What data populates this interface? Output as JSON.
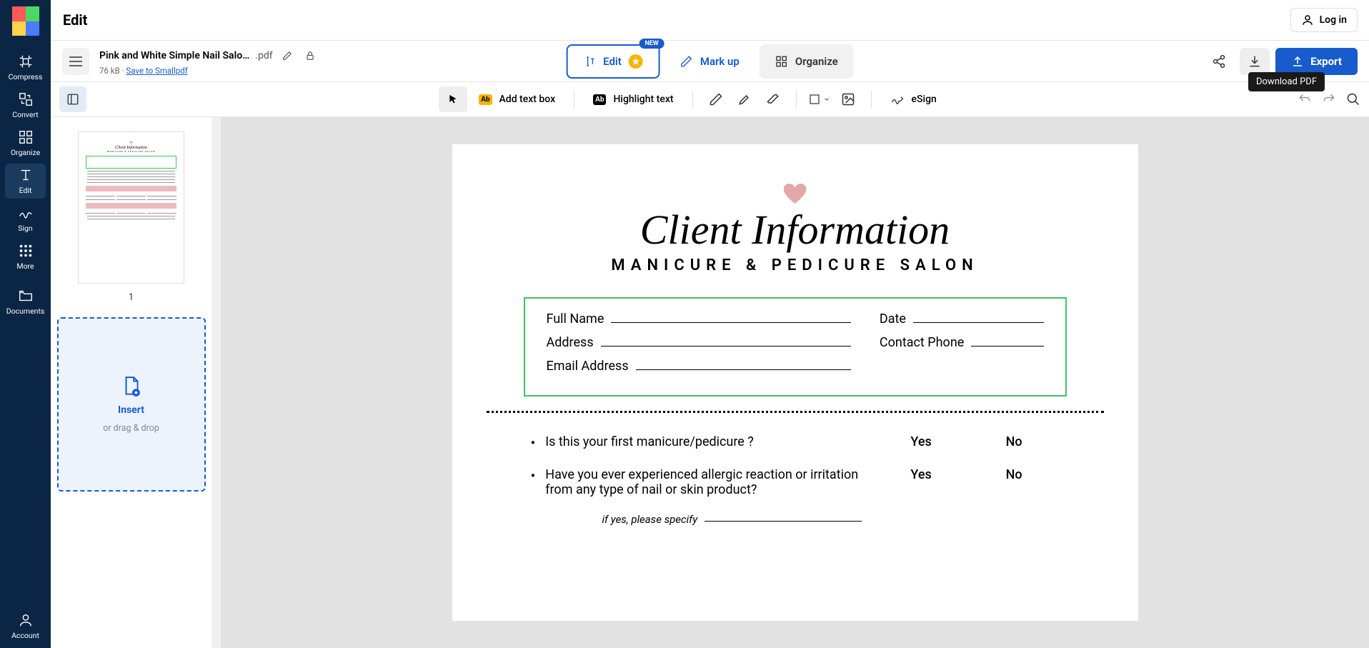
{
  "header": {
    "title": "Edit",
    "login": "Log in"
  },
  "sidebar": {
    "items": [
      {
        "label": "Compress"
      },
      {
        "label": "Convert"
      },
      {
        "label": "Organize"
      },
      {
        "label": "Edit"
      },
      {
        "label": "Sign"
      },
      {
        "label": "More"
      },
      {
        "label": "Documents"
      }
    ],
    "account": "Account"
  },
  "file": {
    "name": "Pink and White Simple Nail Salo…",
    "ext": ".pdf",
    "size": "76 kB",
    "save": "Save to Smallpdf"
  },
  "tabs": {
    "edit": "Edit",
    "markup": "Mark up",
    "organize": "Organize",
    "new_badge": "NEW"
  },
  "actions": {
    "export": "Export"
  },
  "toolbar": {
    "add_text": "Add text box",
    "highlight": "Highlight text",
    "esign": "eSign",
    "tooltip": "Download PDF"
  },
  "thumbs": {
    "page_num": "1",
    "insert": "Insert",
    "insert_sub": "or drag & drop"
  },
  "doc": {
    "title": "Client  Information",
    "subtitle": "MANICURE & PEDICURE SALON",
    "fields": {
      "full_name": "Full Name",
      "date": "Date",
      "address": "Address",
      "phone": "Contact Phone",
      "email": "Email Address"
    },
    "questions": [
      {
        "text": "Is this your first manicure/pedicure ?",
        "yes": "Yes",
        "no": "No"
      },
      {
        "text": "Have you ever experienced allergic reaction or irritation from any type of nail or skin product?",
        "yes": "Yes",
        "no": "No",
        "note": "if yes, please specify"
      }
    ]
  }
}
